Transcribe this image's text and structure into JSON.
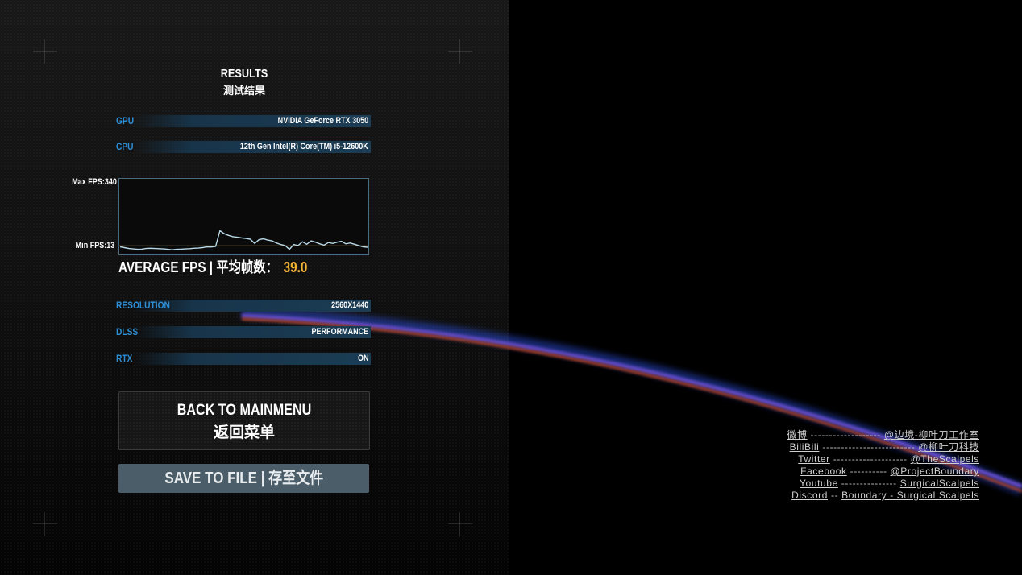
{
  "header": {
    "title_en": "RESULTS",
    "title_zh": "测试结果"
  },
  "hardware": [
    {
      "label": "GPU",
      "value": "NVIDIA GeForce RTX 3050"
    },
    {
      "label": "CPU",
      "value": "12th Gen Intel(R) Core(TM) i5-12600K"
    }
  ],
  "fps": {
    "max_label": "Max FPS:340",
    "min_label": "Min FPS:13",
    "average_label": "AVERAGE FPS | 平均帧数：",
    "average_value": "39.0"
  },
  "chart_data": {
    "type": "line",
    "title": "",
    "xlabel": "",
    "ylabel": "FPS",
    "ylim": [
      13,
      340
    ],
    "y_reference_line": 39.0,
    "grid": false,
    "values": [
      34,
      30,
      26,
      24,
      22,
      23,
      26,
      27,
      26,
      25,
      24,
      22,
      20,
      22,
      23,
      24,
      25,
      27,
      28,
      30,
      34,
      33,
      36,
      110,
      96,
      88,
      82,
      79,
      76,
      74,
      70,
      50,
      68,
      72,
      66,
      62,
      52,
      45,
      40,
      22,
      45,
      40,
      58,
      46,
      62,
      56,
      48,
      42,
      54,
      50,
      56,
      60,
      48,
      52,
      46,
      40,
      34,
      32
    ]
  },
  "settings": [
    {
      "label": "RESOLUTION",
      "value": "2560X1440"
    },
    {
      "label": "DLSS",
      "value": "PERFORMANCE"
    },
    {
      "label": "RTX",
      "value": "ON"
    }
  ],
  "buttons": {
    "back_en": "BACK TO MAINMENU",
    "back_zh": "返回菜单",
    "save": "SAVE TO FILE | 存至文件"
  },
  "social": [
    {
      "platform": "微博",
      "dashes": "-------------------",
      "handle": "@边境-柳叶刀工作室"
    },
    {
      "platform": "BiliBili",
      "dashes": "-------------------------",
      "handle": "@柳叶刀科技"
    },
    {
      "platform": "Twitter",
      "dashes": "--------------------",
      "handle": "@TheScalpels"
    },
    {
      "platform": "Facebook",
      "dashes": "----------",
      "handle": "@ProjectBoundary"
    },
    {
      "platform": "Youtube",
      "dashes": "---------------",
      "handle": "SurgicalScalpels"
    },
    {
      "platform": "Discord",
      "dashes": "--",
      "handle": "Boundary - Surgical Scalpels"
    }
  ],
  "colors": {
    "label_blue": "#2e8fd6",
    "average_gold": "#f2b233",
    "graph_line": "#b8d8e8",
    "save_button": "#4b5d68"
  }
}
